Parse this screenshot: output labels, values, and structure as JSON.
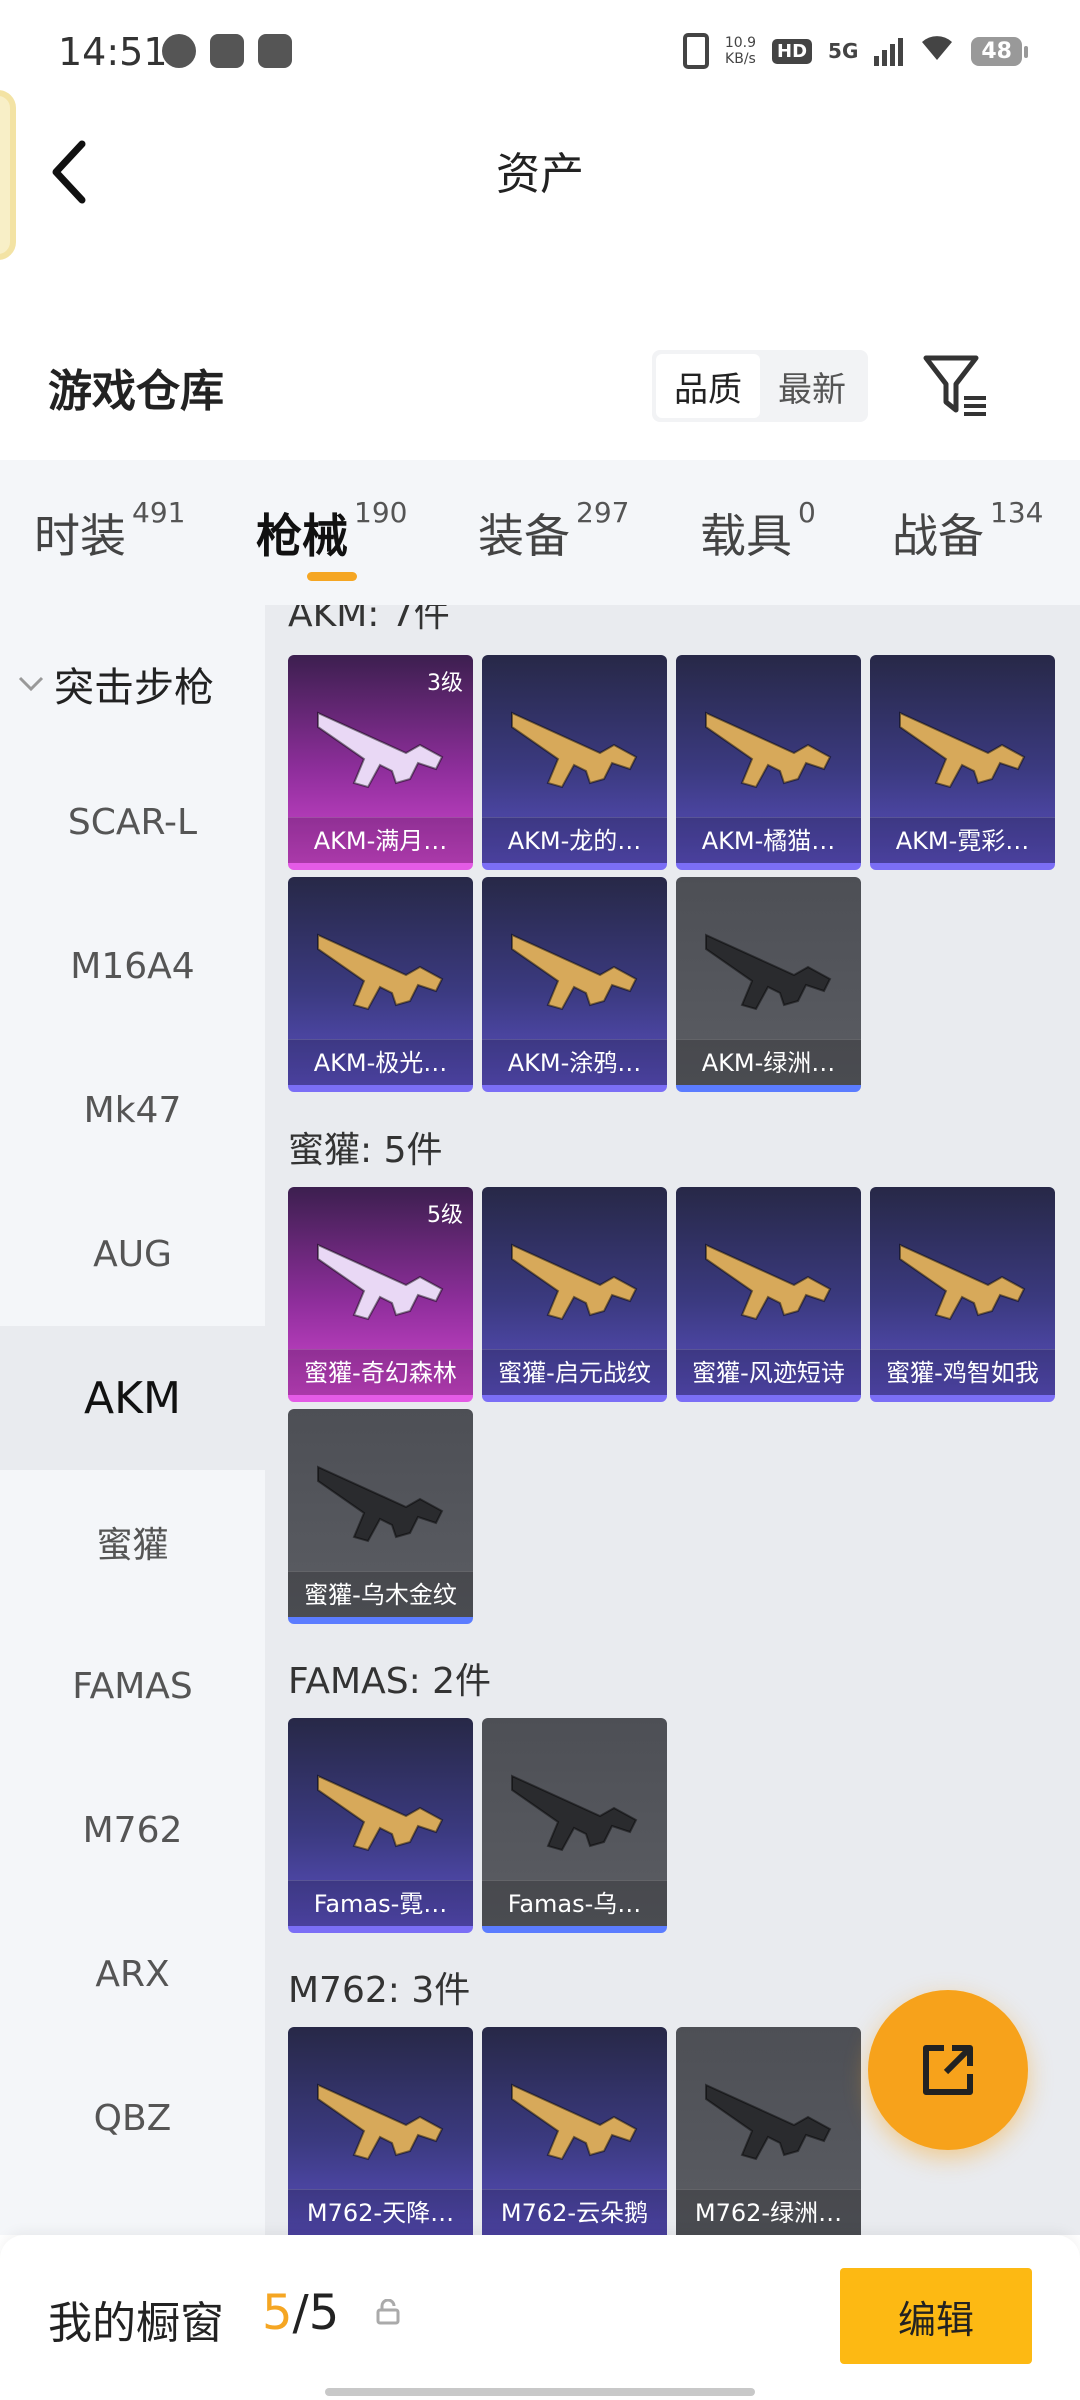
{
  "status_bar": {
    "time": "14:51",
    "net_speed": "10.9",
    "net_unit": "KB/s",
    "hd": "HD",
    "network": "5G",
    "battery": "48"
  },
  "nav": {
    "title": "资产"
  },
  "warehouse": {
    "title": "游戏仓库",
    "sort_options": [
      "品质",
      "最新"
    ],
    "sort_selected": "品质"
  },
  "categories": [
    {
      "label": "时装",
      "count": "491"
    },
    {
      "label": "枪械",
      "count": "190"
    },
    {
      "label": "装备",
      "count": "297"
    },
    {
      "label": "载具",
      "count": "0"
    },
    {
      "label": "战备",
      "count": "134"
    }
  ],
  "sidebar": {
    "group": "突击步枪",
    "items": [
      "SCAR-L",
      "M16A4",
      "Mk47",
      "AUG",
      "AKM",
      "蜜獾",
      "FAMAS",
      "M762",
      "ARX",
      "QBZ"
    ],
    "active": "AKM"
  },
  "sections": [
    {
      "title": "AKM: 7件",
      "items": [
        {
          "name": "AKM-满月…",
          "rarity": "pink",
          "level": "3级"
        },
        {
          "name": "AKM-龙的…",
          "rarity": "purple"
        },
        {
          "name": "AKM-橘猫…",
          "rarity": "purple"
        },
        {
          "name": "AKM-霓彩…",
          "rarity": "purple"
        },
        {
          "name": "AKM-极光…",
          "rarity": "purple"
        },
        {
          "name": "AKM-涂鸦…",
          "rarity": "purple"
        },
        {
          "name": "AKM-绿洲…",
          "rarity": "gray"
        }
      ]
    },
    {
      "title": "蜜獾: 5件",
      "items": [
        {
          "name": "蜜獾-奇幻森林",
          "rarity": "pink",
          "level": "5级"
        },
        {
          "name": "蜜獾-启元战纹",
          "rarity": "purple"
        },
        {
          "name": "蜜獾-风迹短诗",
          "rarity": "purple"
        },
        {
          "name": "蜜獾-鸡智如我",
          "rarity": "purple"
        },
        {
          "name": "蜜獾-乌木金纹",
          "rarity": "gray"
        }
      ]
    },
    {
      "title": "FAMAS: 2件",
      "items": [
        {
          "name": "Famas-霓…",
          "rarity": "purple"
        },
        {
          "name": "Famas-乌…",
          "rarity": "gray"
        }
      ]
    },
    {
      "title": "M762: 3件",
      "items": [
        {
          "name": "M762-天降…",
          "rarity": "purple"
        },
        {
          "name": "M762-云朵鹅",
          "rarity": "purple"
        },
        {
          "name": "M762-绿洲…",
          "rarity": "gray"
        }
      ]
    }
  ],
  "showcase": {
    "label": "我的橱窗",
    "current": "5",
    "separator": "/",
    "total": "5",
    "edit_label": "编辑"
  },
  "colors": {
    "accent": "#f5a623",
    "fab": "#f7a21b",
    "edit_button": "#fdb913"
  }
}
